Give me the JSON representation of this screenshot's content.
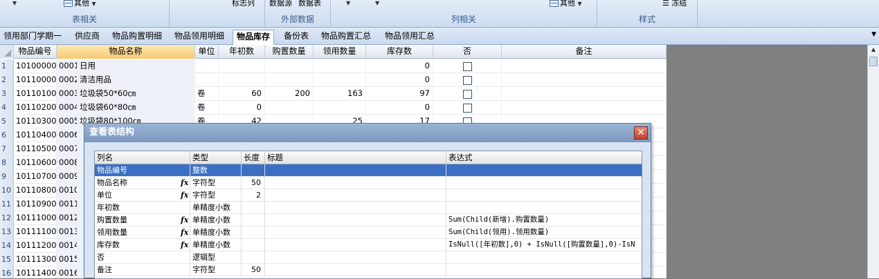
{
  "ribbon": {
    "groups": [
      {
        "label": "表相关"
      },
      {
        "label": "外部数据"
      },
      {
        "label": "列相关"
      },
      {
        "label": "样式"
      }
    ],
    "items": {
      "other1": "其他",
      "flag_col": "标志列",
      "data_source": "数据源",
      "data_table": "数据表",
      "other2": "其他",
      "freeze": "冻结"
    }
  },
  "tabs": [
    "领用部门学期一",
    "供应商",
    "物品购置明细",
    "物品领用明细",
    "物品库存",
    "备份表",
    "物品购置汇总",
    "物品领用汇总"
  ],
  "active_tab": "物品库存",
  "grid": {
    "columns": [
      "物品编号",
      "物品名称",
      "单位",
      "年初数",
      "购置数量",
      "领用数量",
      "库存数",
      "否",
      "备注"
    ],
    "rows": [
      {
        "n": "1",
        "id": "10100000",
        "code": "0001",
        "name": "日用",
        "unit": "",
        "start": "",
        "buy": "",
        "use": "",
        "stock": "0"
      },
      {
        "n": "2",
        "id": "10110000",
        "code": "0002",
        "name": "清洁用品",
        "unit": "",
        "start": "",
        "buy": "",
        "use": "",
        "stock": "0"
      },
      {
        "n": "3",
        "id": "10110100",
        "code": "0003",
        "name": "垃圾袋50*60㎝",
        "unit": "卷",
        "start": "60",
        "buy": "200",
        "use": "163",
        "stock": "97"
      },
      {
        "n": "4",
        "id": "10110200",
        "code": "0004",
        "name": "垃圾袋60*80㎝",
        "unit": "卷",
        "start": "0",
        "buy": "",
        "use": "",
        "stock": "0"
      },
      {
        "n": "5",
        "id": "10110300",
        "code": "0005",
        "name": "垃圾袋80*100㎝",
        "unit": "卷",
        "start": "42",
        "buy": "",
        "use": "25",
        "stock": "17"
      },
      {
        "n": "6",
        "id": "10110400",
        "code": "0006",
        "name": "",
        "unit": "",
        "start": "",
        "buy": "",
        "use": "",
        "stock": ""
      },
      {
        "n": "7",
        "id": "10110500",
        "code": "0007",
        "name": "",
        "unit": "",
        "start": "",
        "buy": "",
        "use": "",
        "stock": ""
      },
      {
        "n": "8",
        "id": "10110600",
        "code": "0008",
        "name": "",
        "unit": "",
        "start": "",
        "buy": "",
        "use": "",
        "stock": ""
      },
      {
        "n": "9",
        "id": "10110700",
        "code": "0009",
        "name": "",
        "unit": "",
        "start": "",
        "buy": "",
        "use": "",
        "stock": ""
      },
      {
        "n": "10",
        "id": "10110800",
        "code": "0010",
        "name": "",
        "unit": "",
        "start": "",
        "buy": "",
        "use": "",
        "stock": ""
      },
      {
        "n": "11",
        "id": "10110900",
        "code": "0011",
        "name": "",
        "unit": "",
        "start": "",
        "buy": "",
        "use": "",
        "stock": ""
      },
      {
        "n": "12",
        "id": "10111000",
        "code": "0012",
        "name": "",
        "unit": "",
        "start": "",
        "buy": "",
        "use": "",
        "stock": ""
      },
      {
        "n": "13",
        "id": "10111100",
        "code": "0013",
        "name": "",
        "unit": "",
        "start": "",
        "buy": "",
        "use": "",
        "stock": ""
      },
      {
        "n": "14",
        "id": "10111200",
        "code": "0014",
        "name": "",
        "unit": "",
        "start": "",
        "buy": "",
        "use": "",
        "stock": ""
      },
      {
        "n": "15",
        "id": "10111300",
        "code": "0015",
        "name": "",
        "unit": "",
        "start": "",
        "buy": "",
        "use": "",
        "stock": ""
      },
      {
        "n": "16",
        "id": "10111400",
        "code": "0016",
        "name": "",
        "unit": "",
        "start": "",
        "buy": "",
        "use": "",
        "stock": ""
      }
    ]
  },
  "dialog": {
    "title": "查看表结构",
    "columns": [
      "列名",
      "类型",
      "长度",
      "标题",
      "表达式"
    ],
    "rows": [
      {
        "name": "物品编号",
        "fx": false,
        "type": "整数",
        "len": "",
        "caption": "",
        "expr": ""
      },
      {
        "name": "物品名称",
        "fx": true,
        "type": "字符型",
        "len": "50",
        "caption": "",
        "expr": ""
      },
      {
        "name": "单位",
        "fx": true,
        "type": "字符型",
        "len": "2",
        "caption": "",
        "expr": ""
      },
      {
        "name": "年初数",
        "fx": false,
        "type": "单精度小数",
        "len": "",
        "caption": "",
        "expr": ""
      },
      {
        "name": "购置数量",
        "fx": true,
        "type": "单精度小数",
        "len": "",
        "caption": "",
        "expr": "Sum(Child(新增).购置数量)"
      },
      {
        "name": "领用数量",
        "fx": true,
        "type": "单精度小数",
        "len": "",
        "caption": "",
        "expr": "Sum(Child(领用).领用数量)"
      },
      {
        "name": "库存数",
        "fx": true,
        "type": "单精度小数",
        "len": "",
        "caption": "",
        "expr": "IsNull([年初数],0) + IsNull([购置数量],0)-IsN"
      },
      {
        "name": "否",
        "fx": false,
        "type": "逻辑型",
        "len": "",
        "caption": "",
        "expr": ""
      },
      {
        "name": "备注",
        "fx": false,
        "type": "字符型",
        "len": "50",
        "caption": "",
        "expr": ""
      }
    ],
    "fx_glyph": "fx"
  },
  "colors": {
    "selection": "#3a6fc4",
    "header_highlight": "#f8c970",
    "desktop": "#808080"
  }
}
